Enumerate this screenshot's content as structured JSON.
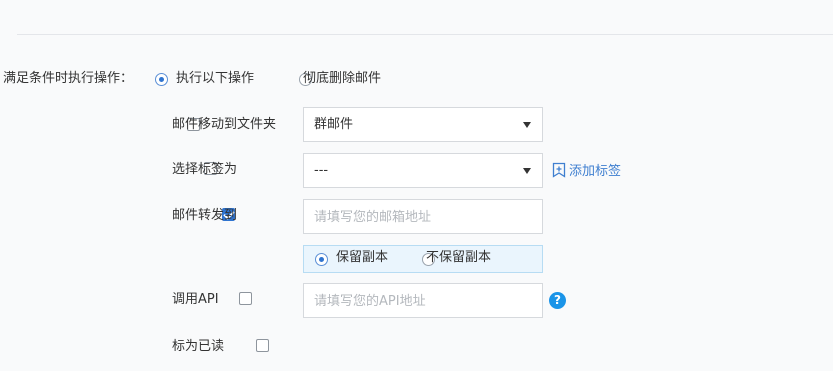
{
  "rule": {
    "condition_label": "满足条件时执行操作：",
    "mode_options": [
      {
        "label": "执行以下操作",
        "selected": true
      },
      {
        "label": "彻底删除邮件",
        "selected": false
      }
    ]
  },
  "actions": {
    "move_to_folder": {
      "label": "邮件移动到文件夹",
      "checked": false,
      "selected_value": "群邮件"
    },
    "select_tag": {
      "label": "选择标签为",
      "checked": false,
      "selected_value": "---",
      "add_tag_label": "添加标签"
    },
    "forward": {
      "label": "邮件转发到",
      "checked": true,
      "email_placeholder": "请填写您的邮箱地址",
      "copy_options": [
        {
          "label": "保留副本",
          "selected": true
        },
        {
          "label": "不保留副本",
          "selected": false
        }
      ]
    },
    "call_api": {
      "label": "调用API",
      "checked": false,
      "url_placeholder": "请填写您的API地址",
      "help_icon": "question-icon",
      "help_glyph": "?"
    },
    "mark_read": {
      "label": "标为已读",
      "checked": false
    }
  },
  "colors": {
    "accent": "#2f74d0",
    "link": "#3f7fd0",
    "help": "#1a94e8",
    "copy_box_bg": "#eaf5fd"
  }
}
